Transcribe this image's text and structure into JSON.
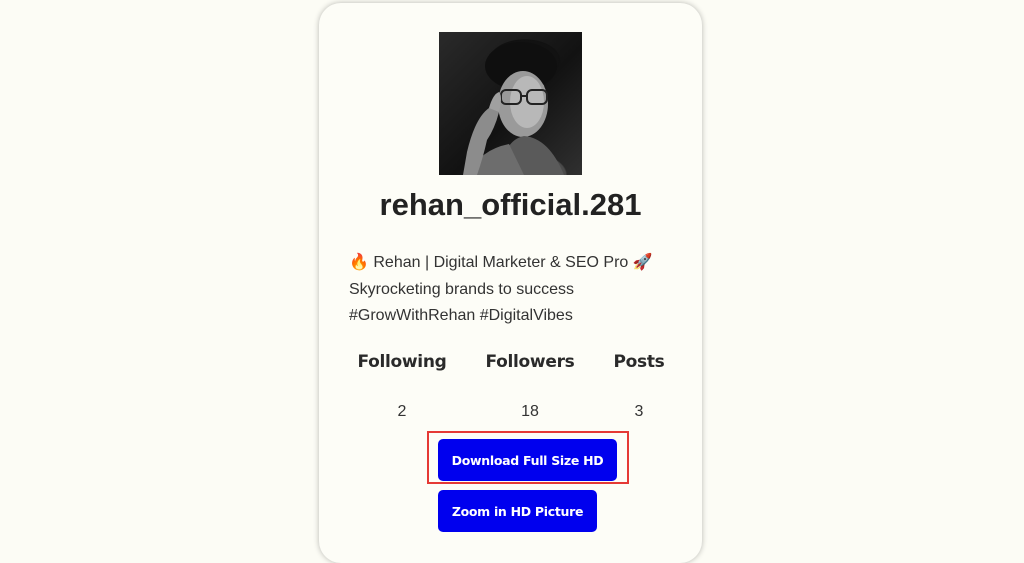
{
  "profile": {
    "username": "rehan_official.281",
    "avatar_icon": "profile-photo",
    "bio_lines": [
      "🔥 Rehan | Digital Marketer & SEO Pro 🚀",
      "Skyrocketing brands to success",
      "#GrowWithRehan #DigitalVibes"
    ]
  },
  "stats": [
    {
      "label": "Following",
      "count": "2"
    },
    {
      "label": "Followers",
      "count": "18"
    },
    {
      "label": "Posts",
      "count": "3"
    }
  ],
  "buttons": {
    "download_label": "Download Full Size HD",
    "zoom_label": "Zoom in HD Picture"
  },
  "colors": {
    "button_bg": "#0000ee",
    "highlight_border": "#e53935",
    "page_bg": "#fcfcf5"
  }
}
